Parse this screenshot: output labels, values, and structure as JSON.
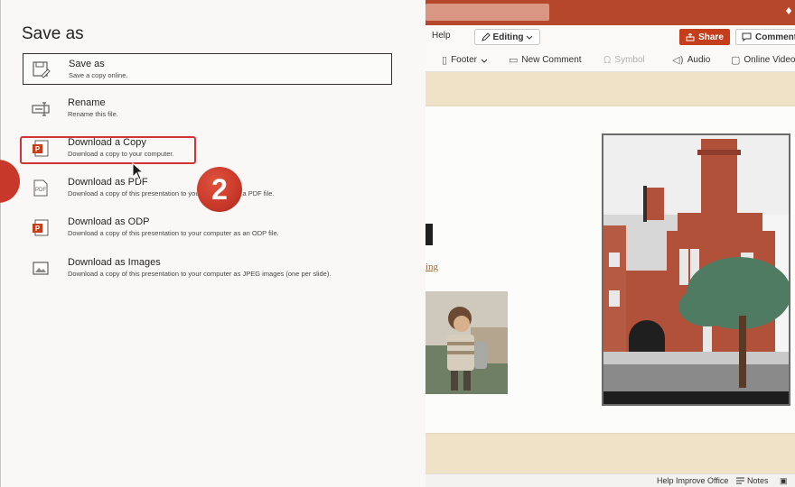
{
  "app": {
    "tabs": {
      "help": "Help"
    },
    "editing_label": "Editing",
    "share_label": "Share",
    "comments_label": "Comments",
    "commands": [
      {
        "label": "Footer",
        "icon": "footer-icon",
        "dropdown": true
      },
      {
        "label": "New Comment",
        "icon": "comment-icon"
      },
      {
        "label": "Symbol",
        "icon": "omega-icon",
        "disabled": true
      },
      {
        "label": "Audio",
        "icon": "audio-icon"
      },
      {
        "label": "Online Video",
        "icon": "video-icon"
      }
    ],
    "slide": {
      "link_fragment": "ing"
    },
    "status": {
      "help_improve": "Help Improve Office",
      "notes": "Notes"
    }
  },
  "panel": {
    "title": "Save as",
    "options": [
      {
        "label": "Save as",
        "description": "Save a copy online.",
        "icon": "save-as-icon"
      },
      {
        "label": "Rename",
        "description": "Rename this file.",
        "icon": "rename-icon"
      },
      {
        "label": "Download a Copy",
        "description": "Download a copy to your computer.",
        "icon": "powerpoint-file-icon"
      },
      {
        "label": "Download as PDF",
        "description": "Download a copy of this presentation to your computer as a PDF file.",
        "icon": "pdf-icon"
      },
      {
        "label": "Download as ODP",
        "description": "Download a copy of this presentation to your computer as an ODP file.",
        "icon": "odp-icon"
      },
      {
        "label": "Download as Images",
        "description": "Download a copy of this presentation to your computer as JPEG images (one per slide).",
        "icon": "image-icon"
      }
    ],
    "step_badge": "2"
  },
  "colors": {
    "accent": "#b7472a",
    "highlight": "#d13438",
    "badge": "#c8382a"
  }
}
